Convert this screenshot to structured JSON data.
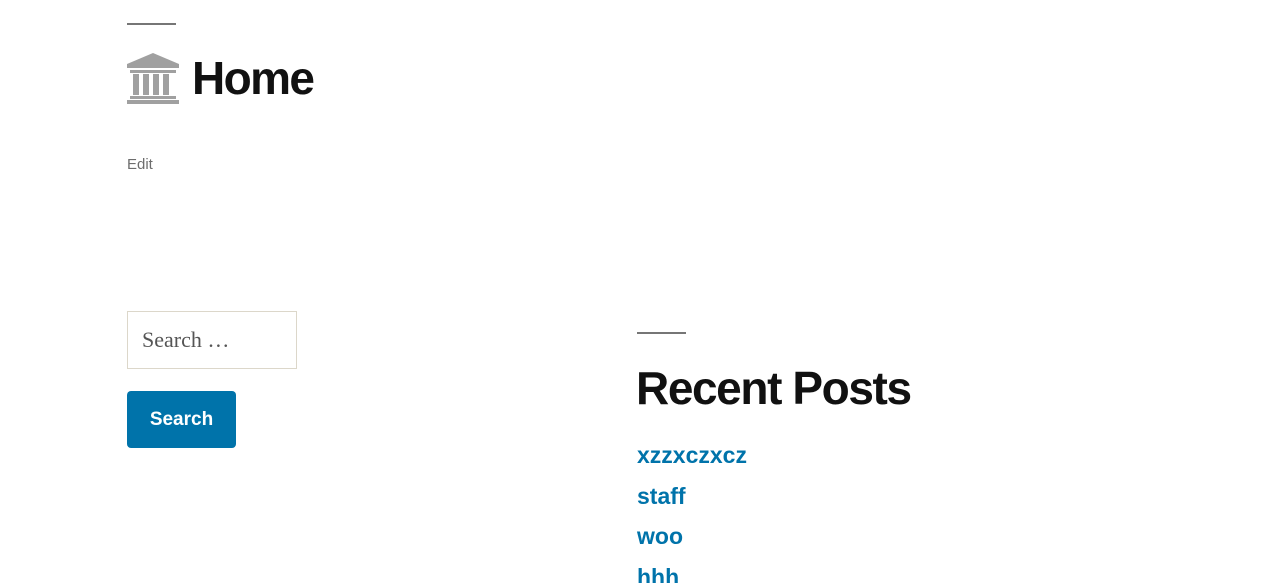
{
  "header": {
    "title": "Home",
    "icon": "bank-icon",
    "icon_color": "#a0a0a0"
  },
  "edit_link": "Edit",
  "search": {
    "placeholder": "Search …",
    "value": "",
    "button_label": "Search"
  },
  "recent_posts": {
    "title": "Recent Posts",
    "items": [
      {
        "label": "xzzxczxcz"
      },
      {
        "label": "staff"
      },
      {
        "label": "woo"
      },
      {
        "label": "hhh"
      }
    ]
  },
  "colors": {
    "link": "#0073aa",
    "button_bg": "#0073aa",
    "heading": "#111111",
    "rule": "#767676"
  }
}
